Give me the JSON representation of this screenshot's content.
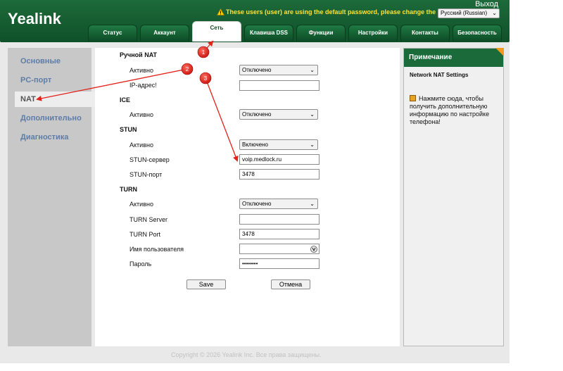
{
  "header": {
    "logo": "Yealink",
    "logout": "Выход",
    "warning": "These users (user) are using the default password, please change the password!",
    "language": "Русский (Russian)"
  },
  "tabs": [
    {
      "label": "Статус"
    },
    {
      "label": "Аккаунт"
    },
    {
      "label": "Сеть"
    },
    {
      "label": "Клавиша DSS"
    },
    {
      "label": "Функции"
    },
    {
      "label": "Настройки"
    },
    {
      "label": "Контакты"
    },
    {
      "label": "Безопасность"
    }
  ],
  "sidebar": {
    "items": [
      {
        "label": "Основные"
      },
      {
        "label": "PC-порт"
      },
      {
        "label": "NAT"
      },
      {
        "label": "Дополнительно"
      },
      {
        "label": "Диагностика"
      }
    ]
  },
  "form": {
    "manual_nat": {
      "title": "Ручной NAT",
      "active_label": "Активно",
      "active_value": "Отключено",
      "ip_label": "IP-адрес!",
      "ip_value": ""
    },
    "ice": {
      "title": "ICE",
      "active_label": "Активно",
      "active_value": "Отключено"
    },
    "stun": {
      "title": "STUN",
      "active_label": "Активно",
      "active_value": "Включено",
      "server_label": "STUN-сервер",
      "server_value": "voip.medlock.ru",
      "port_label": "STUN-порт",
      "port_value": "3478"
    },
    "turn": {
      "title": "TURN",
      "active_label": "Активно",
      "active_value": "Отключено",
      "server_label": "TURN Server",
      "server_value": "",
      "port_label": "TURN Port",
      "port_value": "3478",
      "username_label": "Имя пользователя",
      "username_value": "",
      "password_label": "Пароль",
      "password_value": "••••••••"
    },
    "save_label": "Save",
    "cancel_label": "Отмена"
  },
  "note": {
    "header": "Примечание",
    "title": "Network NAT Settings",
    "text": "Нажмите сюда, чтобы получить дополнительную информацию по настройке телефона!"
  },
  "footer": "Copyright © 2026 Yealink Inc. Все права защищены.",
  "annotations": [
    "1",
    "2",
    "3"
  ],
  "colors": {
    "brand_green": "#1b6b3a",
    "marker_red": "#e3221c",
    "link_blue": "#5d7da8",
    "note_corner": "#f29a1e"
  }
}
